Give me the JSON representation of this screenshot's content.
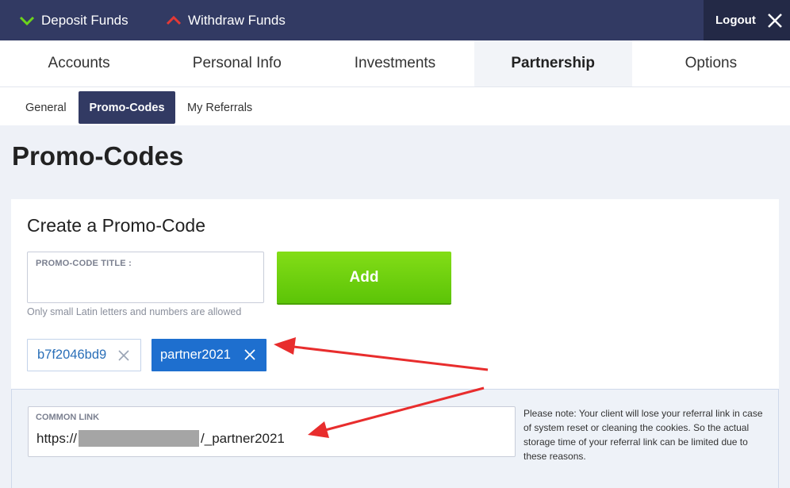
{
  "topbar": {
    "deposit_label": "Deposit Funds",
    "withdraw_label": "Withdraw Funds",
    "logout_label": "Logout",
    "deposit_icon": "chevron-down-icon",
    "withdraw_icon": "chevron-up-icon",
    "logout_icon": "close-icon"
  },
  "main_tabs": [
    {
      "label": "Accounts",
      "active": false
    },
    {
      "label": "Personal Info",
      "active": false
    },
    {
      "label": "Investments",
      "active": false
    },
    {
      "label": "Partnership",
      "active": true
    },
    {
      "label": "Options",
      "active": false
    }
  ],
  "sub_tabs": [
    {
      "label": "General",
      "active": false
    },
    {
      "label": "Promo-Codes",
      "active": true
    },
    {
      "label": "My Referrals",
      "active": false
    }
  ],
  "page_title": "Promo-Codes",
  "create": {
    "title": "Create a Promo-Code",
    "field_label": "PROMO-CODE TITLE :",
    "field_value": "",
    "hint": "Only small Latin letters and numbers are allowed",
    "add_label": "Add"
  },
  "promo_codes": [
    {
      "code": "b7f2046bd9",
      "selected": false
    },
    {
      "code": "partner2021",
      "selected": true
    }
  ],
  "common_link": {
    "label": "COMMON LINK",
    "prefix": "https://",
    "suffix": "/_partner2021"
  },
  "note": "Please note: Your client will lose your referral link in case of system reset or cleaning the cookies. So the actual storage time of your referral link can be limited due to these reasons.",
  "colors": {
    "topbar": "#323a63",
    "logout_bg": "#232946",
    "deposit_chevron": "#6cd41b",
    "withdraw_chevron": "#e53935",
    "add_button": "#6fd00e",
    "selected_chip": "#1e6fcf",
    "annotation_arrow": "#e82d2d"
  }
}
